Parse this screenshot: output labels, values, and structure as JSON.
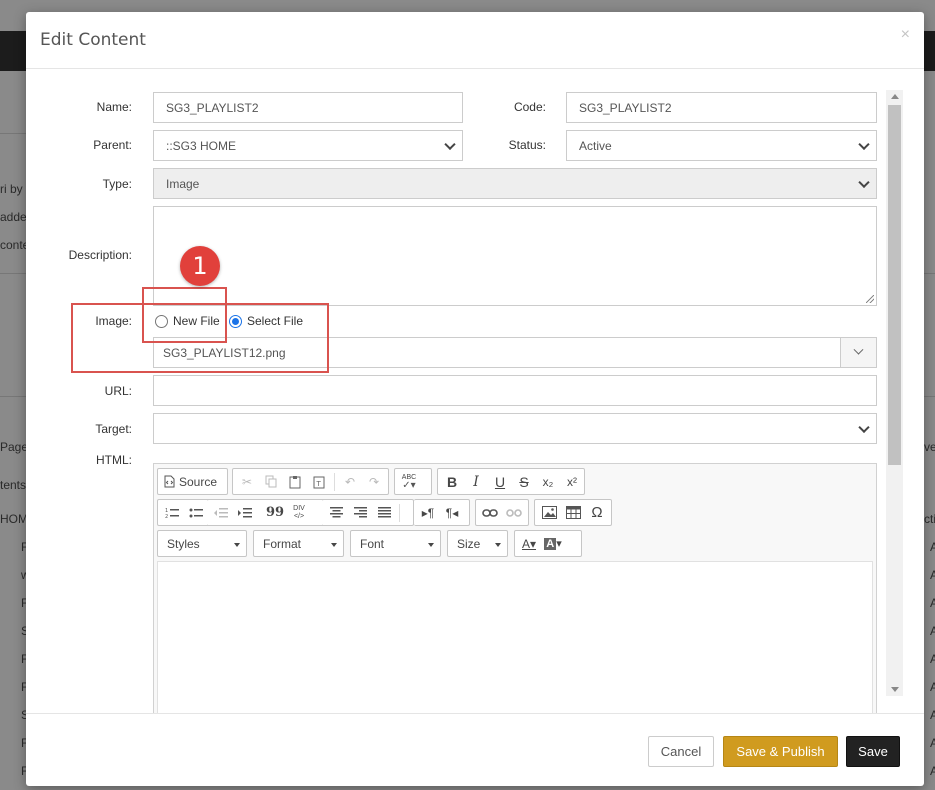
{
  "background": {
    "left_fragments": [
      "ri by",
      "adde",
      "conte",
      "Page",
      "tents",
      "HOM",
      "F",
      "w",
      "F",
      "S",
      "F",
      "F",
      "S",
      "F",
      "F"
    ],
    "right_fragments": [
      "ve",
      "ctiv",
      "A",
      "A",
      "A",
      "A",
      "A",
      "A",
      "A",
      "A",
      "A"
    ]
  },
  "modal": {
    "title": "Edit Content",
    "close_glyph": "×",
    "form": {
      "name_label": "Name:",
      "name_value": "SG3_PLAYLIST2",
      "code_label": "Code:",
      "code_value": "SG3_PLAYLIST2",
      "parent_label": "Parent:",
      "parent_value": "::SG3 HOME",
      "status_label": "Status:",
      "status_value": "Active",
      "type_label": "Type:",
      "type_value": "Image",
      "description_label": "Description:",
      "description_value": "",
      "image_label": "Image:",
      "image_options": [
        "New File",
        "Select File"
      ],
      "image_selected": "Select File",
      "image_file": "SG3_PLAYLIST12.png",
      "url_label": "URL:",
      "url_value": "",
      "target_label": "Target:",
      "target_value": "",
      "html_label": "HTML:"
    },
    "editor": {
      "source_label": "Source",
      "combos": [
        "Styles",
        "Format",
        "Font",
        "Size"
      ],
      "row1": [
        "cut-icon",
        "copy-icon",
        "paste-icon",
        "paste-text-icon",
        "undo-icon",
        "redo-icon",
        "spellcheck-icon",
        "bold-icon",
        "italic-icon",
        "underline-icon",
        "strikethrough-icon",
        "subscript-icon",
        "superscript-icon"
      ],
      "row2": [
        "numbered-list-icon",
        "bulleted-list-icon",
        "outdent-icon",
        "indent-icon",
        "blockquote-icon",
        "div-icon",
        "align-left-icon",
        "align-center-icon",
        "align-right-icon",
        "justify-icon",
        "ltr-icon",
        "rtl-icon",
        "link-icon",
        "unlink-icon",
        "image-icon",
        "table-icon",
        "special-char-icon"
      ],
      "glyphs": {
        "bold": "B",
        "italic": "I",
        "underline": "U",
        "strike": "S",
        "subscript": "x₂",
        "superscript": "x²",
        "omega": "Ω",
        "quote": "99",
        "div": "DIV",
        "spell": "ABC"
      }
    },
    "footer": {
      "cancel_label": "Cancel",
      "publish_label": "Save & Publish",
      "save_label": "Save"
    }
  },
  "annotation": {
    "badge_number": "1",
    "color": "#d9534f"
  },
  "colors": {
    "publish_bg": "#d09b1f",
    "save_bg": "#222222",
    "radio_checked": "#1a73e8"
  }
}
